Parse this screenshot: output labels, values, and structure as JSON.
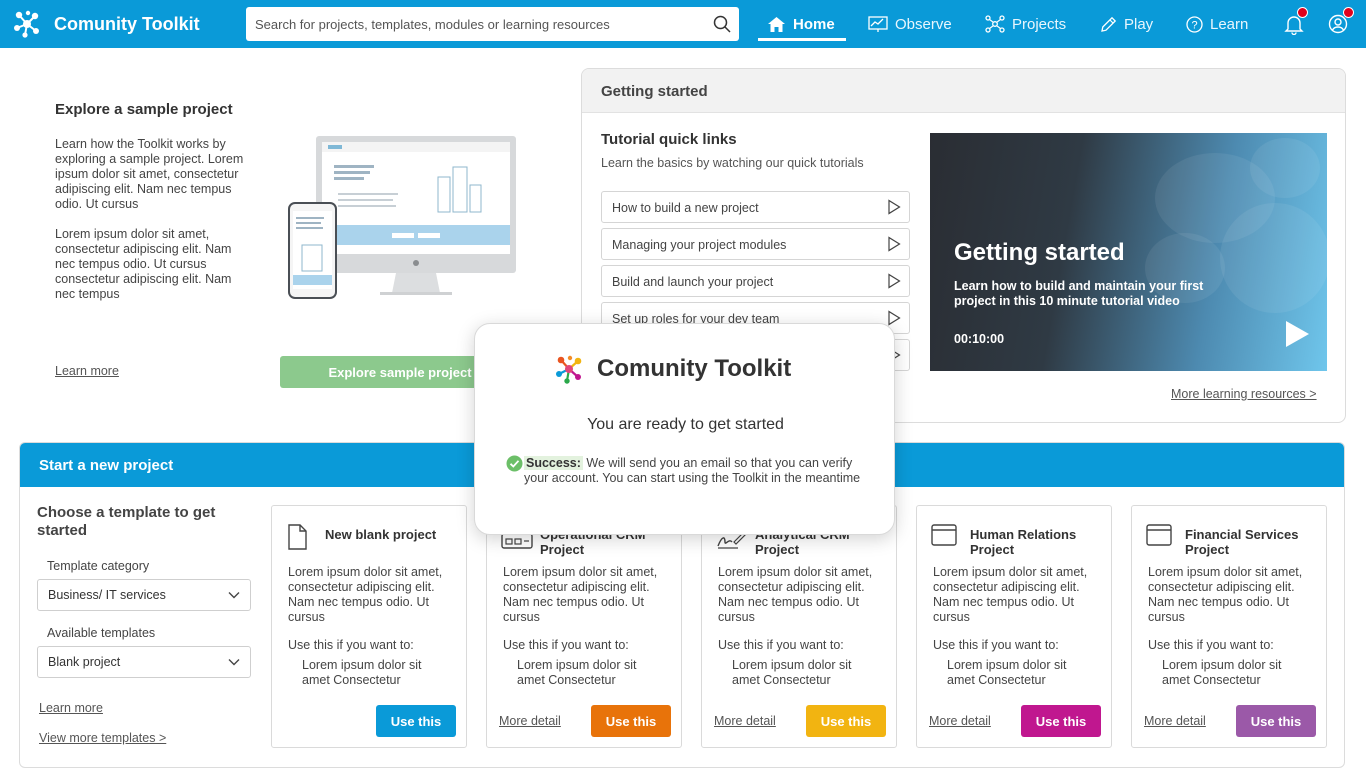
{
  "header": {
    "app_name": "Comunity Toolkit",
    "search_placeholder": "Search for projects, templates, modules or learning resources",
    "nav": [
      {
        "label": "Home",
        "icon": "home-icon",
        "active": true
      },
      {
        "label": "Observe",
        "icon": "observe-icon",
        "active": false
      },
      {
        "label": "Projects",
        "icon": "projects-icon",
        "active": false
      },
      {
        "label": "Play",
        "icon": "play-pencil-icon",
        "active": false
      },
      {
        "label": "Learn",
        "icon": "help-icon",
        "active": false
      }
    ],
    "colors": {
      "bar": "#0a9ad8",
      "notification_dot": "#e0001b"
    }
  },
  "sample": {
    "title": "Explore a sample project",
    "para1": "Learn how the Toolkit works by exploring a sample project. Lorem ipsum dolor sit amet, consectetur adipiscing elit. Nam nec tempus odio. Ut cursus",
    "para2": "Lorem ipsum dolor sit amet, consectetur adipiscing elit. Nam nec tempus odio. Ut cursus consectetur adipiscing elit. Nam nec tempus",
    "learn_more": "Learn more",
    "button": "Explore sample project"
  },
  "getting_started": {
    "title": "Getting started",
    "quick_links_title": "Tutorial quick links",
    "quick_links_sub": "Learn the basics by watching our quick tutorials",
    "links": [
      "How to build a new project",
      "Managing your project modules",
      "Build and launch your project",
      "Set up roles for your dev team"
    ],
    "video": {
      "title": "Getting started",
      "subtitle": "Learn how to build and maintain your first project in this 10 minute tutorial video",
      "duration": "00:10:00"
    },
    "more_link": "More learning resources >"
  },
  "new_project": {
    "title": "Start a new project",
    "choose": "Choose a template to get started",
    "category_label": "Template category",
    "category_value": "Business/ IT services",
    "templates_label": "Available templates",
    "templates_value": "Blank project",
    "learn_more": "Learn more",
    "view_more": "View more templates >",
    "cards": [
      {
        "title": "New blank project",
        "icon": "document-icon",
        "desc": "Lorem ipsum dolor sit amet, consectetur adipiscing elit. Nam nec tempus odio. Ut cursus",
        "use_if": "Use this if you want to:",
        "bullet": "Lorem ipsum dolor sit amet Consectetur",
        "more": "",
        "button": "Use this",
        "color": "#0a9ad8"
      },
      {
        "title": "Operational CRM Project",
        "icon": "crm-icon",
        "desc": "Lorem ipsum dolor sit amet, consectetur adipiscing elit. Nam nec tempus odio. Ut cursus",
        "use_if": "Use this if you want to:",
        "bullet": "Lorem ipsum dolor sit amet Consectetur",
        "more": "More detail",
        "button": "Use this",
        "color": "#e8730a"
      },
      {
        "title": "Analytical CRM Project",
        "icon": "signature-icon",
        "desc": "Lorem ipsum dolor sit amet, consectetur adipiscing elit. Nam nec tempus odio. Ut cursus",
        "use_if": "Use this if you want to:",
        "bullet": "Lorem ipsum dolor sit amet Consectetur",
        "more": "More detail",
        "button": "Use this",
        "color": "#f2b411"
      },
      {
        "title": "Human Relations Project",
        "icon": "window-icon",
        "desc": "Lorem ipsum dolor sit amet, consectetur adipiscing elit. Nam nec tempus odio. Ut cursus",
        "use_if": "Use this if you want to:",
        "bullet": "Lorem ipsum dolor sit amet Consectetur",
        "more": "More detail",
        "button": "Use this",
        "color": "#c0178f"
      },
      {
        "title": "Financial Services Project",
        "icon": "window-icon",
        "desc": "Lorem ipsum dolor sit amet, consectetur adipiscing elit. Nam nec tempus odio. Ut cursus",
        "use_if": "Use this if you want to:",
        "bullet": "Lorem ipsum dolor sit amet Consectetur",
        "more": "More detail",
        "button": "Use this",
        "color": "#9b59a8"
      }
    ]
  },
  "modal": {
    "app_name": "Comunity Toolkit",
    "heading": "You are ready to get started",
    "success_label": "Success:",
    "message": "We will send you an email so that you can verify your account. You can start using the Toolkit in the meantime"
  }
}
